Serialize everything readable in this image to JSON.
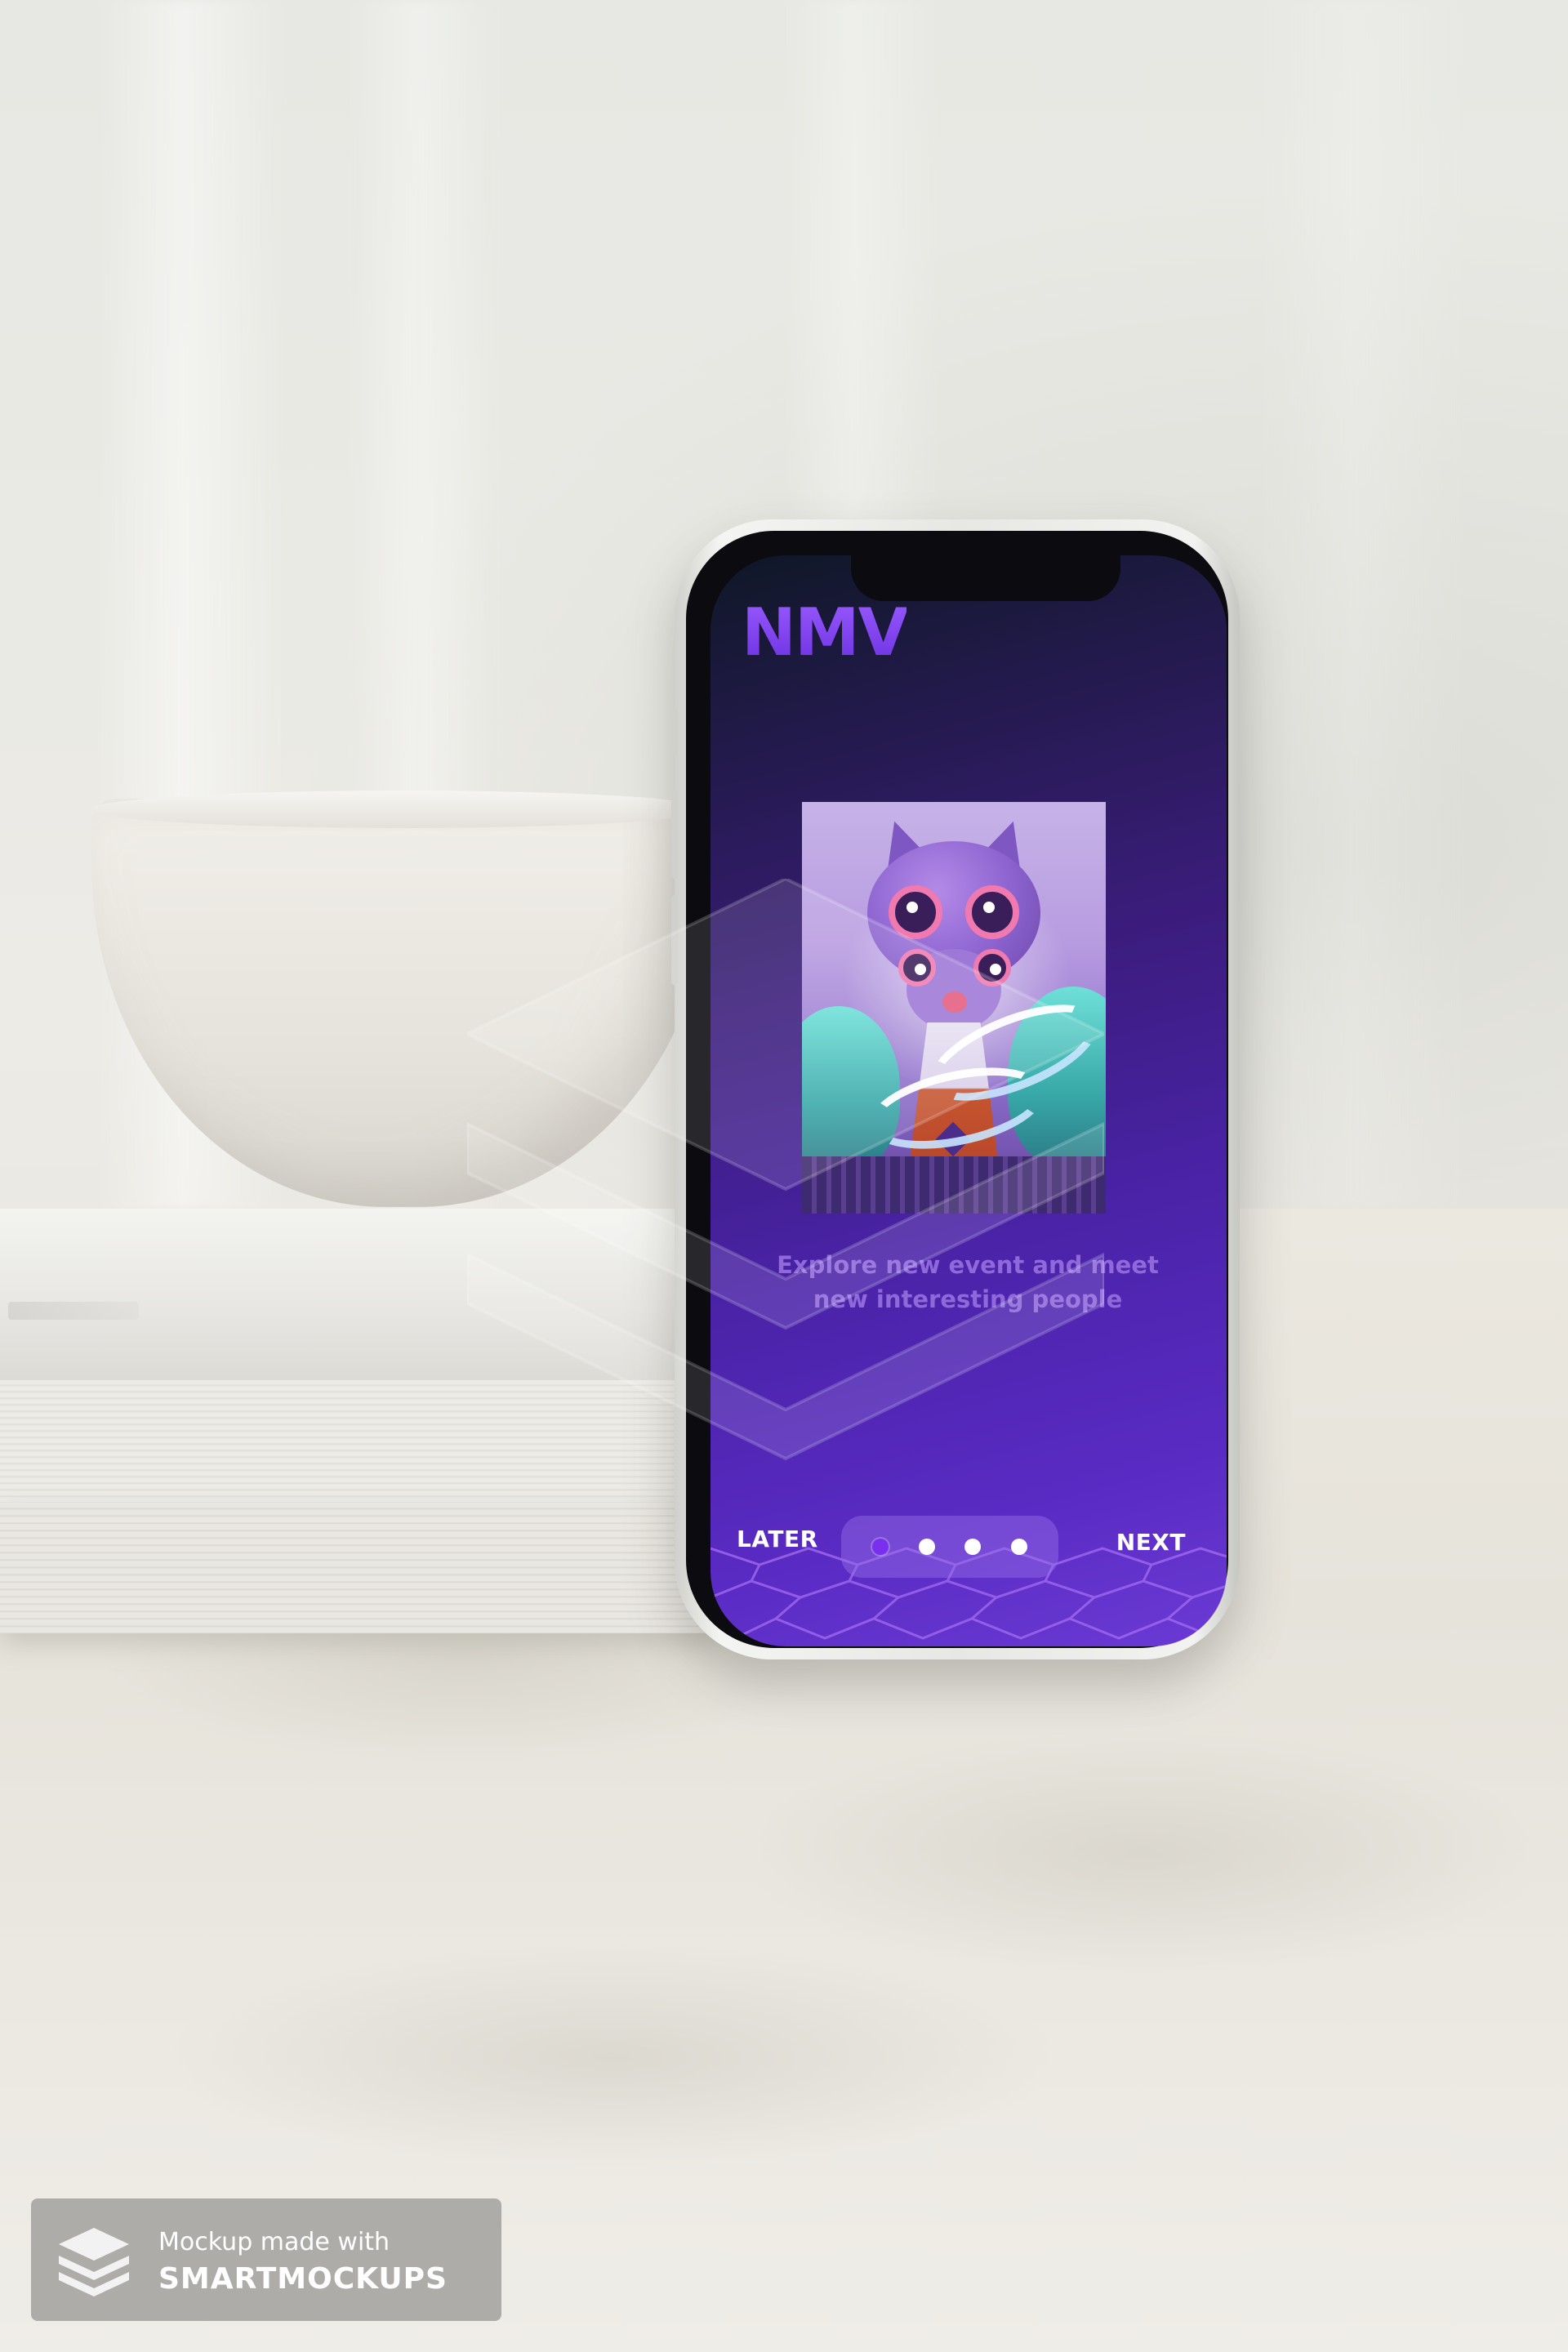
{
  "app": {
    "logo_text": "NMV",
    "brand_color": "#7a3ff2"
  },
  "onboarding": {
    "illustration": "owl-cat-character-illustration",
    "tagline": "Explore new event and meet new interesting people",
    "pagination": {
      "total": 4,
      "current": 1
    },
    "later_label": "LATER",
    "next_label": "NEXT"
  },
  "watermark": {
    "line1": "Mockup made with",
    "line2": "SMARTMOCKUPS",
    "icon": "layers-icon"
  },
  "colors": {
    "screen_top": "#0f1726",
    "screen_mid": "#3a1c7a",
    "screen_bottom": "#6b3ad4",
    "dot_active": "#7a2ff0",
    "dot_inactive": "#ffffff"
  }
}
